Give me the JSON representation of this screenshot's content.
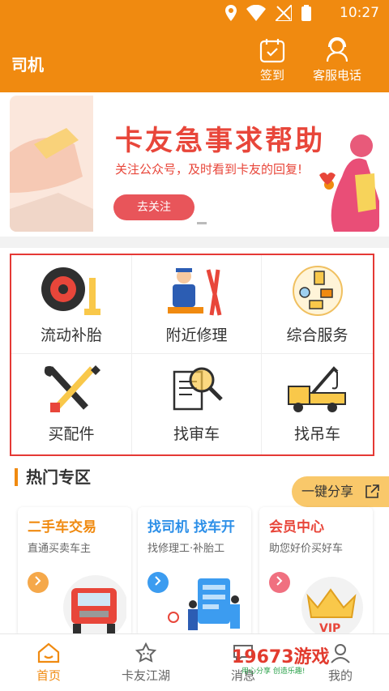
{
  "status_bar": {
    "time": "10:27"
  },
  "header": {
    "title": "司机",
    "signin_label": "签到",
    "service_label": "客服电话"
  },
  "banner": {
    "title": "卡友急事求帮助",
    "subtitle": "关注公众号，及时看到卡友的回复!",
    "button": "去关注"
  },
  "services": [
    {
      "label": "流动补胎",
      "icon": "tire-icon"
    },
    {
      "label": "附近修理",
      "icon": "mechanic-icon"
    },
    {
      "label": "综合服务",
      "icon": "service-icon"
    },
    {
      "label": "买配件",
      "icon": "tools-icon"
    },
    {
      "label": "找审车",
      "icon": "inspection-icon"
    },
    {
      "label": "找吊车",
      "icon": "tow-truck-icon"
    }
  ],
  "hot": {
    "title": "热门专区",
    "share": "一键分享",
    "cards": [
      {
        "title": "二手车交易",
        "subtitle": "直通买卖车主",
        "color": "#f08a10"
      },
      {
        "title": "找司机  找车开",
        "subtitle": "找修理工·补胎工",
        "color": "#2c8fe8"
      },
      {
        "title": "会员中心",
        "subtitle": "助您好价买好车",
        "color": "#e8463a"
      }
    ]
  },
  "nav": {
    "items": [
      "首页",
      "卡友江湖",
      "消息",
      "我的"
    ],
    "active": "首页"
  },
  "watermark": {
    "text": "19673游戏",
    "sub": "用心分享  创造乐趣!"
  },
  "colors": {
    "brand": "#f08a10",
    "accent_red": "#e8463a",
    "highlight_border": "#e53935"
  }
}
